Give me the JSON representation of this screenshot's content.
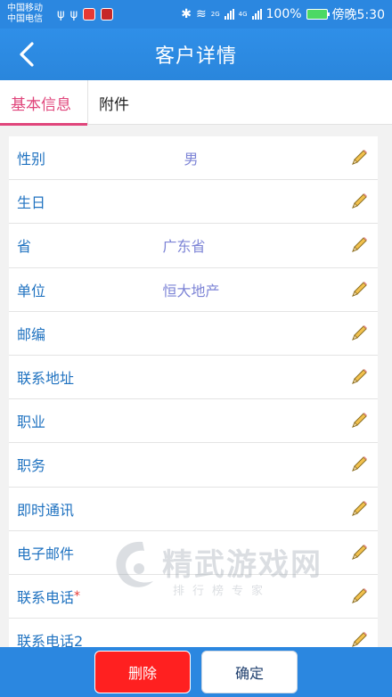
{
  "status_bar": {
    "carrier_1": "中国移动",
    "carrier_2": "中国电信",
    "net_1": "2G",
    "net_2": "4G",
    "battery": "100%",
    "time": "傍晚5:30"
  },
  "header": {
    "title": "客户详情"
  },
  "tabs": [
    {
      "label": "基本信息",
      "active": true
    },
    {
      "label": "附件",
      "active": false
    }
  ],
  "fields": [
    {
      "label": "性别",
      "value": "男"
    },
    {
      "label": "生日",
      "value": ""
    },
    {
      "label": "省",
      "value": "广东省"
    },
    {
      "label": "单位",
      "value": "恒大地产"
    },
    {
      "label": "邮编",
      "value": ""
    },
    {
      "label": "联系地址",
      "value": ""
    },
    {
      "label": "职业",
      "value": ""
    },
    {
      "label": "职务",
      "value": ""
    },
    {
      "label": "即时通讯",
      "value": ""
    },
    {
      "label": "电子邮件",
      "value": ""
    },
    {
      "label": "联系电话",
      "value": "",
      "required_mark": "*"
    },
    {
      "label": "联系电话2",
      "value": ""
    }
  ],
  "watermark": {
    "text": "精武游戏网",
    "sub": "排行榜专家"
  },
  "footer": {
    "delete_label": "删除",
    "confirm_label": "确定"
  },
  "colors": {
    "header": "#2b87e0",
    "accent": "#e0457b",
    "label": "#1f72c0",
    "value": "#7d84d6",
    "delete": "#ff2020"
  }
}
